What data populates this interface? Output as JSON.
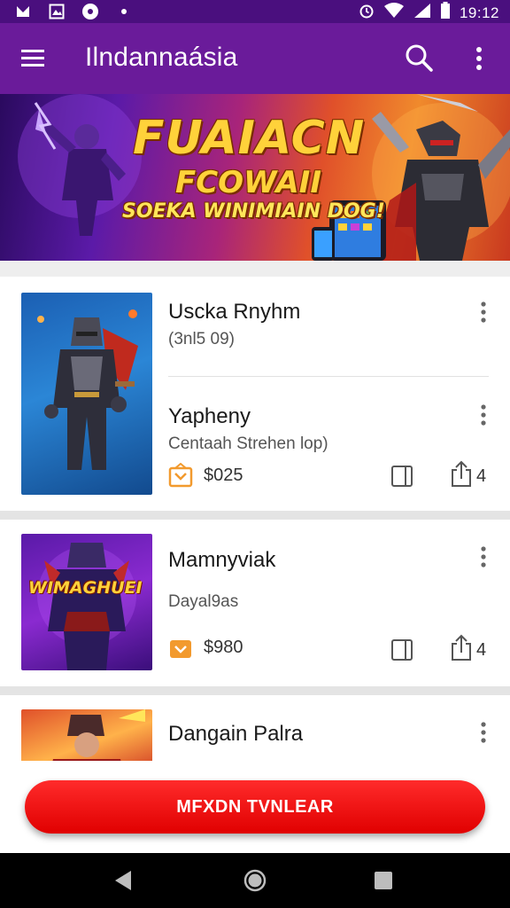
{
  "status_bar": {
    "time": "19:12"
  },
  "app_bar": {
    "title": "Ilndannaásia"
  },
  "banner": {
    "headline": "FUAIACN",
    "subheadline": "FCOWAII",
    "tagline": "SOEKA WINIMIAIN DOG!"
  },
  "cards": [
    {
      "entries": [
        {
          "title": "Uscka Rnyhm",
          "subtitle": "(3nl5 09)"
        },
        {
          "title": "Yapheny",
          "subtitle": "Centaah Strehen lop)"
        }
      ],
      "price": "$025",
      "share_count": "4"
    },
    {
      "title": "Mamnyviak",
      "subtitle": "Dayal9as",
      "thumb_text": "WIMAGHUEI",
      "price": "$980",
      "share_count": "4"
    },
    {
      "title": "Dangain Palra"
    }
  ],
  "cta": {
    "label": "MFXDN TVNLEAR"
  },
  "colors": {
    "app_bar": "#6a1b9a",
    "status_bar": "#4a0f7e",
    "cta": "#e00000",
    "price_icon": "#f29a2e"
  },
  "icons": {
    "menu": "hamburger-icon",
    "search": "search-icon",
    "more": "more-vert-icon",
    "price": "wallet-icon",
    "bookmark": "book-icon",
    "share": "share-icon"
  }
}
